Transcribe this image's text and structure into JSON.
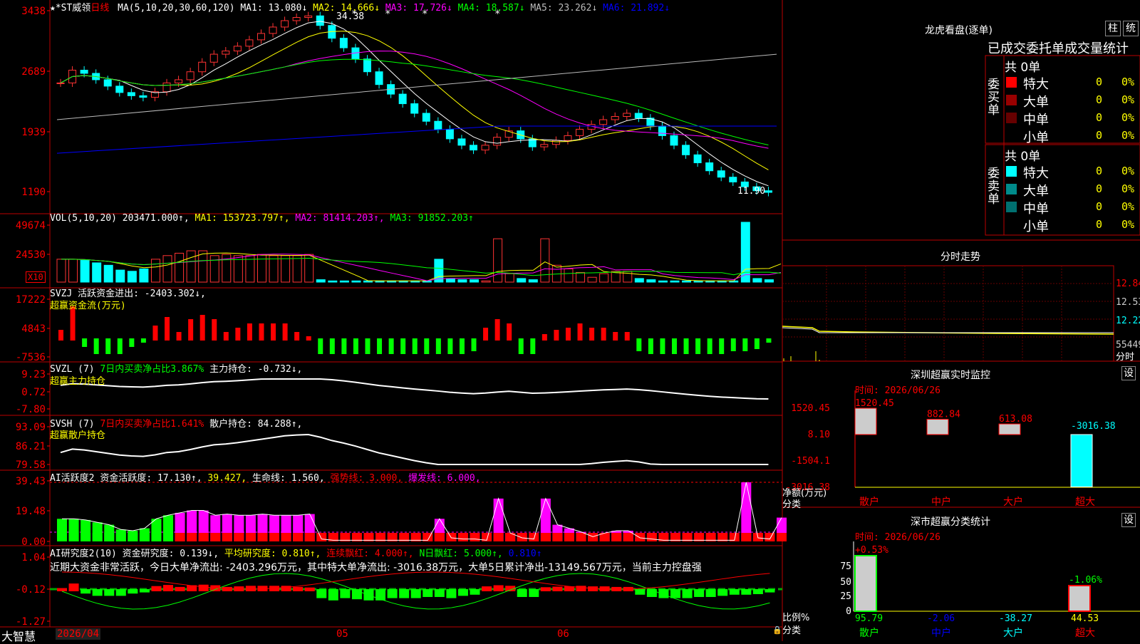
{
  "stock": {
    "name": "★*ST威领",
    "period": "日线"
  },
  "panels": {
    "kline": {
      "ma_label": "MA(5,10,20,30,60,120)",
      "ma": [
        {
          "label": "MA1: 13.080↓",
          "color": "#ffffff"
        },
        {
          "label": "MA2: 14.666↓",
          "color": "#ffff00"
        },
        {
          "label": "MA3: 17.726↓",
          "color": "#ff00ff"
        },
        {
          "label": "MA4: 18.587↓",
          "color": "#00ff00"
        },
        {
          "label": "MA5: 23.262↓",
          "color": "#bbbbbb"
        },
        {
          "label": "MA6: 21.892↓",
          "color": "#0000ff"
        }
      ],
      "y_ticks": [
        "3438",
        "2689",
        "1939",
        "1190"
      ],
      "high_label": "34.38",
      "low_label": "11.90"
    },
    "vol": {
      "label": "VOL(5,10,20)",
      "value": "203471.000↑,",
      "ma": [
        {
          "label": "MA1: 153723.797↑,",
          "color": "#ffff00"
        },
        {
          "label": "MA2: 81414.203↑,",
          "color": "#ff00ff"
        },
        {
          "label": "MA3: 91852.203↑",
          "color": "#00ff00"
        }
      ],
      "y_ticks": [
        "49674",
        "24530"
      ],
      "unit": "X10"
    },
    "svzj": {
      "label": "SVZJ  活跃资金进出: -2403.302↓,",
      "sub": "超赢资金流(万元)",
      "y_ticks": [
        "17222",
        "4843",
        "-7536"
      ]
    },
    "svzl": {
      "label": "SVZL (7)",
      "l2": "7日内买卖净占比3.867%",
      "l3": "主力持仓: -0.732↓,",
      "sub": "超赢主力持仓",
      "y_ticks": [
        "9.23",
        "0.72",
        "-7.80"
      ]
    },
    "svsh": {
      "label": "SVSH (7)",
      "l2": "7日内买卖净占比1.641%",
      "l3": "散户持仓: 84.288↑,",
      "sub": "超赢散户持仓",
      "y_ticks": [
        "93.09",
        "86.21",
        "79.58"
      ]
    },
    "ai1": {
      "label": "AI活跃度2",
      "l2": "资金活跃度: 17.130↑,",
      "l3": "39.427,",
      "l4": "生命线: 1.560,",
      "l5": "强势线: 3.000,",
      "l6": "爆发线: 6.000,",
      "y_ticks": [
        "39.43",
        "19.48",
        "0.00"
      ]
    },
    "ai2": {
      "label": "AI研究度2(10)",
      "l2": "资金研究度: 0.139↓,",
      "l3": "平均研究度: 0.810↑,",
      "l4": "连续飘红: 4.000↑,",
      "l5": "N日飘红: 5.000↑,",
      "l6": "0.810↑",
      "desc": "近期大资金非常活跃，今日大单净流出: -2403.296万元，其中特大单净流出: -3016.38万元，大单5日累计净出-13149.567万元，当前主力控盘强",
      "y_ticks": [
        "1.04",
        "-0.12",
        "-1.27"
      ]
    }
  },
  "bottom": {
    "brand": "大智慧",
    "date": "2026/04",
    "m5": "05",
    "m6": "06"
  },
  "right": {
    "lhb_title": "龙虎看盘(逐单)",
    "btn_zhu": "柱",
    "btn_stat": "统",
    "stats_title": "已成交委托单成交量统计",
    "buy": {
      "side": "委买单",
      "total": "共 0单",
      "rows": [
        {
          "label": "特大",
          "color": "#ff0000",
          "n": "0",
          "p": "0%"
        },
        {
          "label": "大单",
          "color": "#990000",
          "n": "0",
          "p": "0%"
        },
        {
          "label": "中单",
          "color": "#660000",
          "n": "0",
          "p": "0%"
        },
        {
          "label": "小单",
          "color": "#000000",
          "n": "0",
          "p": "0%"
        }
      ]
    },
    "sell": {
      "side": "委卖单",
      "total": "共 0单",
      "rows": [
        {
          "label": "特大",
          "color": "#00ffff",
          "n": "0",
          "p": "0%"
        },
        {
          "label": "大单",
          "color": "#008b8b",
          "n": "0",
          "p": "0%"
        },
        {
          "label": "中单",
          "color": "#007070",
          "n": "0",
          "p": "0%"
        },
        {
          "label": "小单",
          "color": "#000000",
          "n": "0",
          "p": "0%"
        }
      ]
    },
    "intraday_title": "分时走势",
    "intraday_ticks": [
      "12.84",
      "12.53",
      "12.22",
      "55449",
      "分时"
    ],
    "sz_title": "深圳超赢实时监控",
    "sz_btn": "设",
    "sz_time": "时间: 2026/06/26",
    "sz_y": [
      "1520.45",
      "8.10",
      "-1504.1",
      "-3016.38"
    ],
    "sz_bars": [
      {
        "cat": "散户",
        "val": 1520.45,
        "label": "1520.45"
      },
      {
        "cat": "中户",
        "val": 882.84,
        "label": "882.84"
      },
      {
        "cat": "大户",
        "val": 613.08,
        "label": "613.08"
      },
      {
        "cat": "超大",
        "val": -3016.38,
        "label": "-3016.38"
      }
    ],
    "sz_ylabel": "净额(万元)",
    "sz_xlabel": "分类",
    "cls_title": "深市超赢分类统计",
    "cls_btn": "设",
    "cls_time": "时间: 2026/06/26",
    "cls_y": [
      "75",
      "50",
      "25",
      "0"
    ],
    "cls_top1": "+0.53%",
    "cls_top4": "-1.06%",
    "cls_vals": [
      "95.79",
      "-2.06",
      "-38.27",
      "44.53"
    ],
    "cls_cats": [
      "散户",
      "中户",
      "大户",
      "超大"
    ],
    "cls_ylabel": "比例%",
    "cls_xlabel": "分类"
  },
  "chart_data": {
    "type": "candlestick",
    "price_range": [
      11.9,
      34.38
    ],
    "closes": [
      25.6,
      27.2,
      26.8,
      26.0,
      25.2,
      24.4,
      24.0,
      23.8,
      24.5,
      25.6,
      26.0,
      27.0,
      28.2,
      29.2,
      29.6,
      30.2,
      31.0,
      31.8,
      32.6,
      33.4,
      33.8,
      34.0,
      32.8,
      31.2,
      30.0,
      28.6,
      27.0,
      25.4,
      24.2,
      23.0,
      21.8,
      20.8,
      19.8,
      18.6,
      17.8,
      17.2,
      17.8,
      18.8,
      19.6,
      18.6,
      17.6,
      17.9,
      18.4,
      19.0,
      19.8,
      20.4,
      21.0,
      21.4,
      21.8,
      21.2,
      20.2,
      19.0,
      17.8,
      16.6,
      15.6,
      14.6,
      13.8,
      13.2,
      12.6,
      12.1,
      11.9
    ],
    "volume": [
      19000,
      19000,
      18000,
      16000,
      14000,
      10000,
      9000,
      11000,
      19000,
      22000,
      24000,
      26000,
      26000,
      22000,
      23000,
      22000,
      22000,
      23000,
      22000,
      22000,
      22000,
      23000,
      2000,
      1000,
      1000,
      1000,
      1000,
      1000,
      1000,
      1000,
      1000,
      1000,
      19000,
      3000,
      2000,
      2000,
      1000,
      36000,
      7000,
      3000,
      2000,
      36000,
      14000,
      11000,
      8000,
      4000,
      7000,
      9000,
      9000,
      3000,
      2000,
      1000,
      1000,
      1000,
      1000,
      1000,
      1000,
      1000,
      49674,
      3000,
      2000,
      20000
    ]
  }
}
